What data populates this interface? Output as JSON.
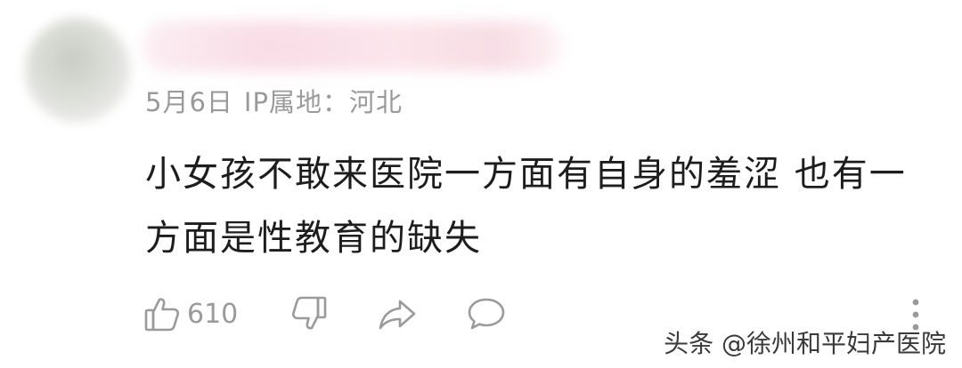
{
  "comment": {
    "date": "5月6日",
    "ip_location": "IP属地：河北",
    "text": "小女孩不敢来医院一方面有自身的羞涩 也有一方面是性教育的缺失"
  },
  "actions": {
    "like_count": "610"
  },
  "watermark": "头条 @徐州和平妇产医院"
}
